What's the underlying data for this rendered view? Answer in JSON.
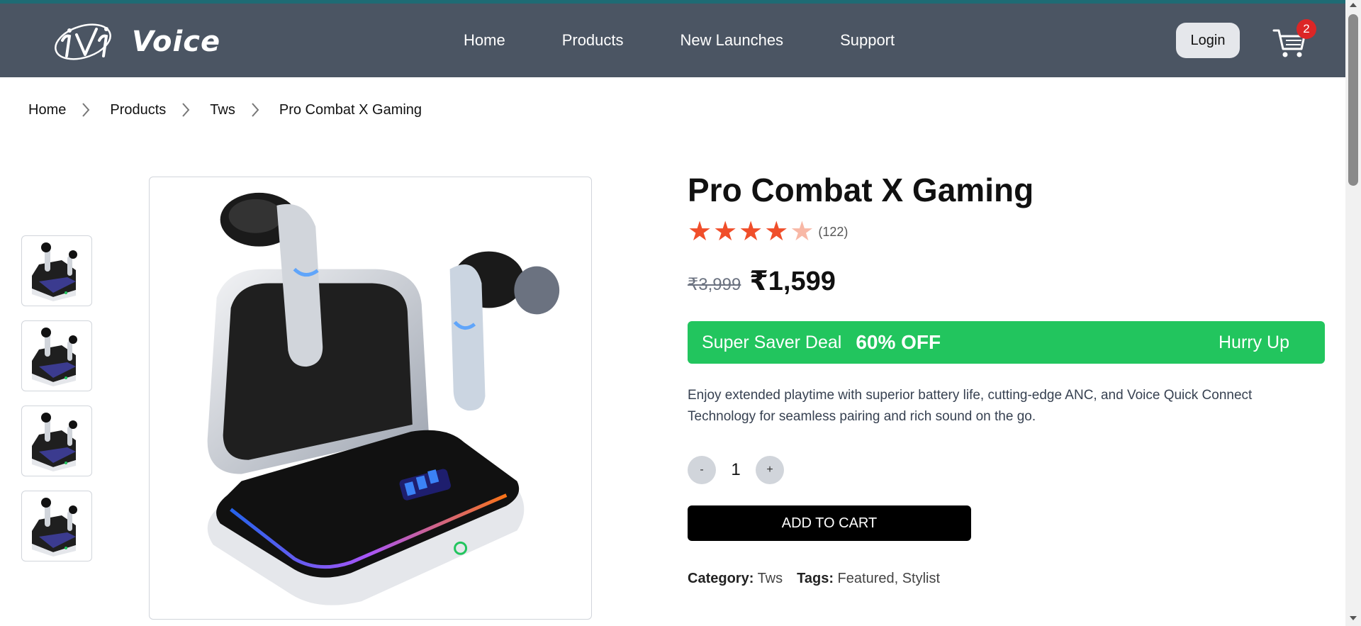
{
  "brand": {
    "name": "Voice",
    "logo_icon": "voice-logo-icon"
  },
  "nav": {
    "items": [
      "Home",
      "Products",
      "New Launches",
      "Support"
    ]
  },
  "header": {
    "login_label": "Login",
    "cart_count": "2"
  },
  "breadcrumb": [
    "Home",
    "Products",
    "Tws",
    "Pro Combat X Gaming"
  ],
  "product": {
    "title": "Pro Combat X Gaming",
    "rating": 4.0,
    "rating_count": "(122)",
    "old_price": "₹3,999",
    "price": "₹1,599",
    "deal": {
      "label": "Super Saver Deal",
      "discount": "60% OFF",
      "urgency": "Hurry Up"
    },
    "description": "Enjoy extended playtime with superior battery life, cutting-edge ANC, and Voice Quick Connect Technology for seamless pairing and rich sound on the go.",
    "quantity": {
      "decrement": "-",
      "value": "1",
      "increment": "+"
    },
    "add_to_cart": "ADD TO CART",
    "category_label": "Category:",
    "category": "Tws",
    "tags_label": "Tags:",
    "tags": "Featured, Stylist"
  },
  "colors": {
    "header_bg": "#4b5563",
    "deal_bg": "#22c55e",
    "star": "#f04e2a",
    "badge": "#dc2626"
  }
}
